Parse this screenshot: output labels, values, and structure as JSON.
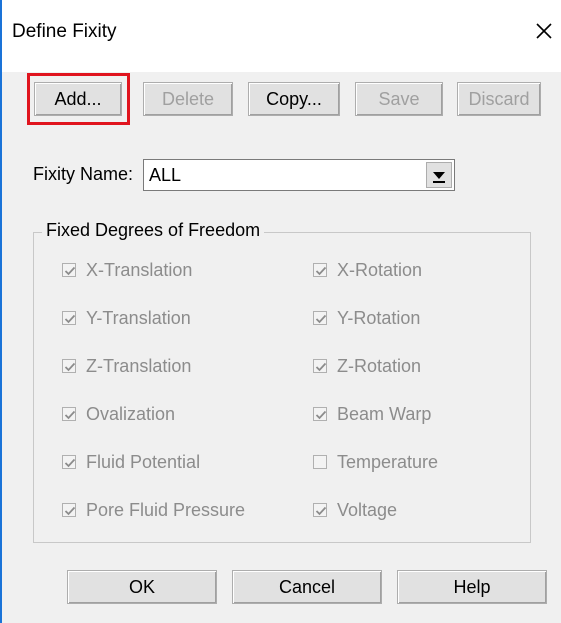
{
  "dialog": {
    "title": "Define Fixity",
    "close_glyph": "✕"
  },
  "toolbar": {
    "add": "Add...",
    "delete": "Delete",
    "copy": "Copy...",
    "save": "Save",
    "discard": "Discard"
  },
  "fixity": {
    "label": "Fixity Name:",
    "selected": "ALL"
  },
  "group": {
    "title": "Fixed Degrees of Freedom",
    "left": [
      {
        "label": "X-Translation",
        "checked": true
      },
      {
        "label": "Y-Translation",
        "checked": true
      },
      {
        "label": "Z-Translation",
        "checked": true
      },
      {
        "label": "Ovalization",
        "checked": true
      },
      {
        "label": "Fluid Potential",
        "checked": true
      },
      {
        "label": "Pore Fluid Pressure",
        "checked": true
      }
    ],
    "right": [
      {
        "label": "X-Rotation",
        "checked": true
      },
      {
        "label": "Y-Rotation",
        "checked": true
      },
      {
        "label": "Z-Rotation",
        "checked": true
      },
      {
        "label": "Beam Warp",
        "checked": true
      },
      {
        "label": "Temperature",
        "checked": false
      },
      {
        "label": "Voltage",
        "checked": true
      }
    ]
  },
  "footer": {
    "ok": "OK",
    "cancel": "Cancel",
    "help": "Help"
  },
  "colors": {
    "highlight": "#e0141e",
    "accent_edge": "#1a73d8"
  }
}
